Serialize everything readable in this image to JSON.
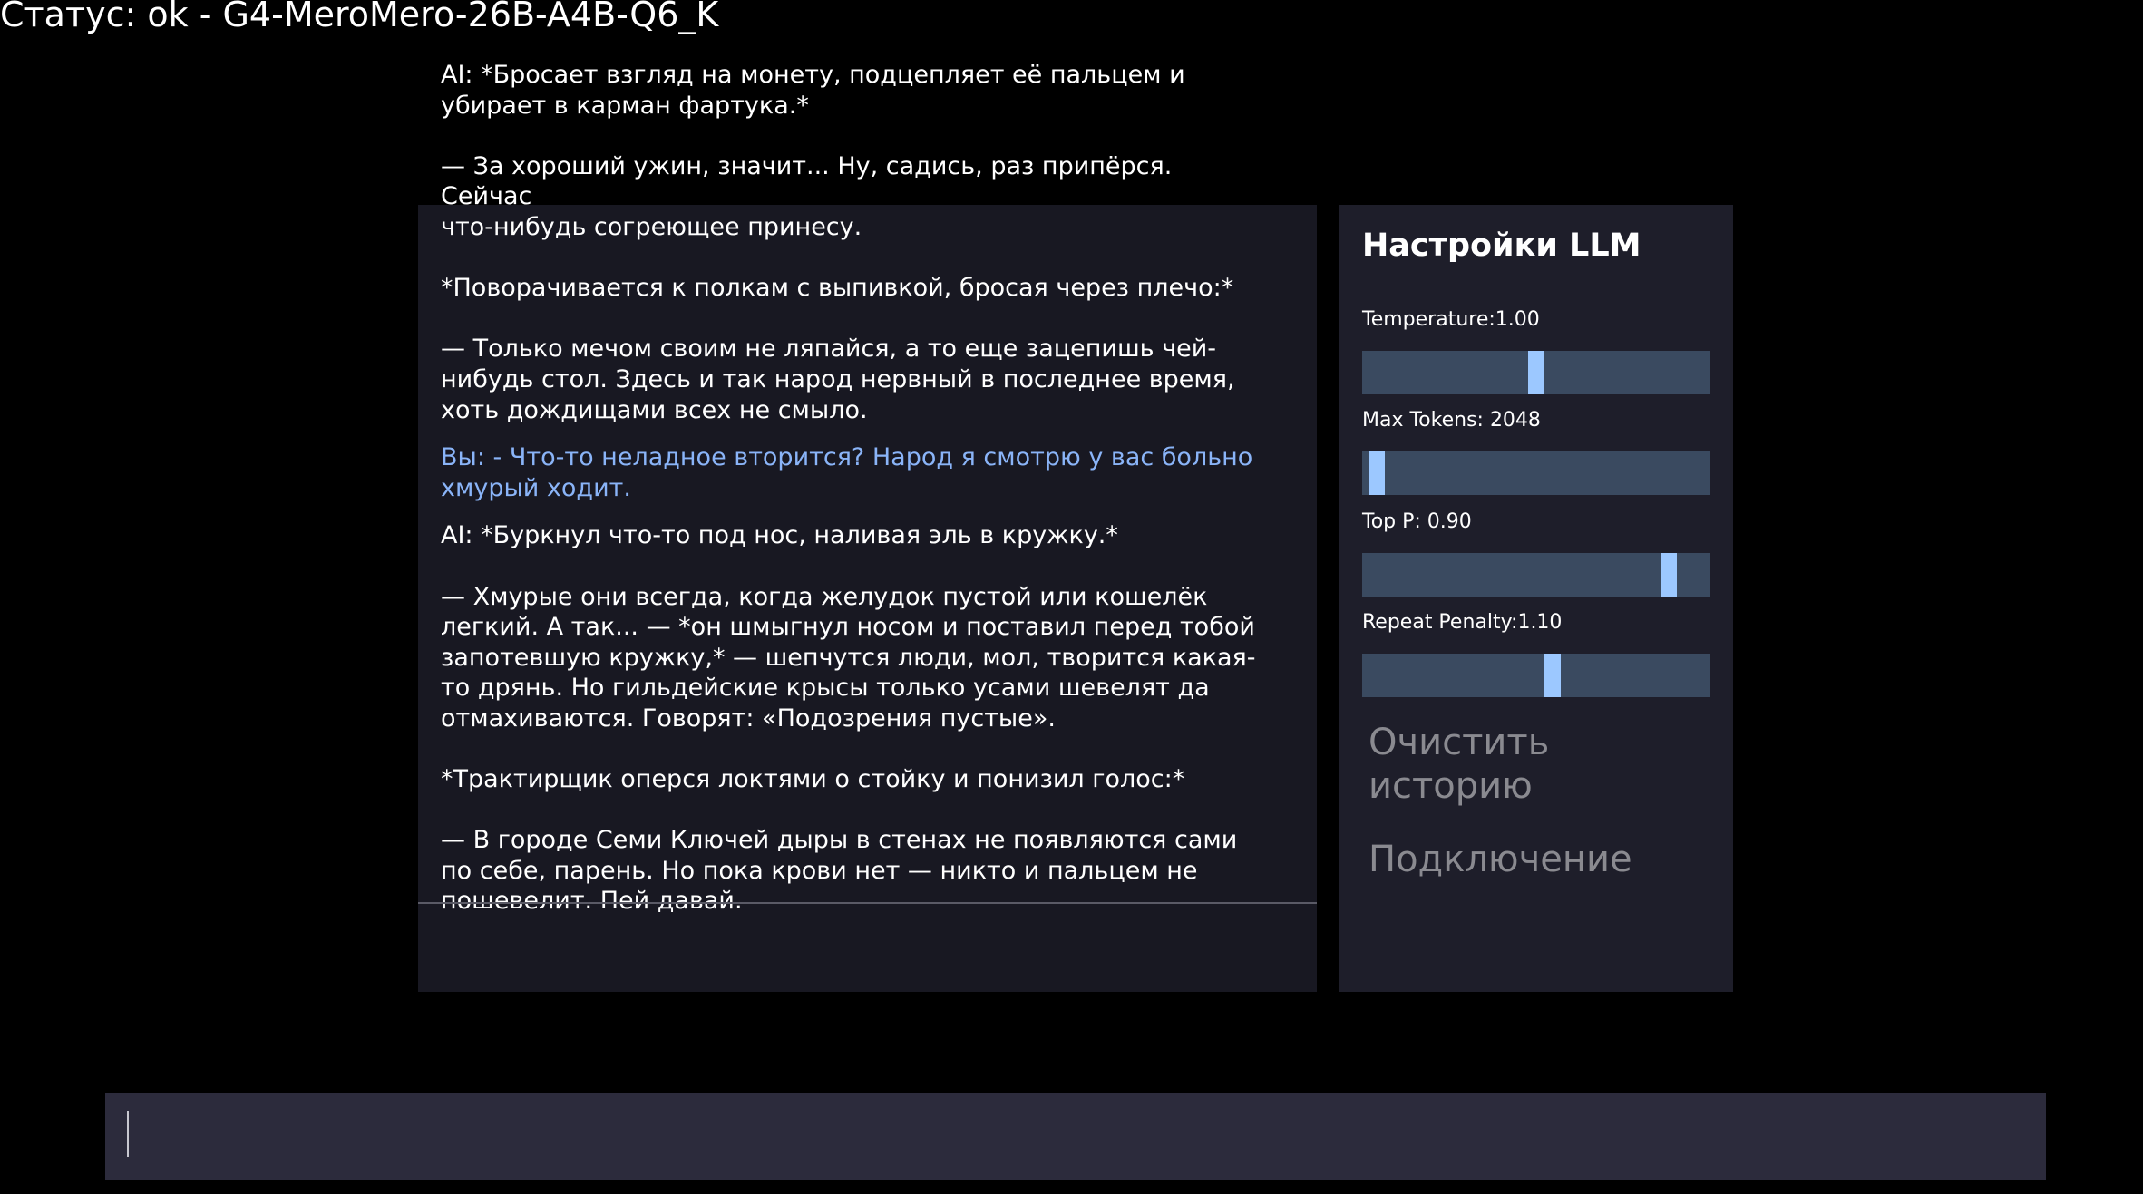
{
  "status": {
    "text": "Статус: ok - G4-MeroMero-26B-A4B-Q6_K"
  },
  "chat": {
    "messages": [
      {
        "role": "ai",
        "text": "AI: *Бросает взгляд на монету, подцепляет её пальцем и\nубирает в карман фартука.*\n\n— За хороший ужин, значит... Ну, садись, раз припёрся. Сейчас\nчто-нибудь согреющее принесу.\n\n*Поворачивается к полкам с выпивкой, бросая через плечо:*\n\n— Только мечом своим не ляпайся, а то еще зацепишь чей-\nнибудь стол. Здесь и так народ нервный в последнее время,\nхоть дождищами всех не смыло."
      },
      {
        "role": "user",
        "text": "Вы: - Что-то неладное вторится? Народ я смотрю у вас больно\nхмурый ходит."
      },
      {
        "role": "ai",
        "text": "AI: *Буркнул что-то под нос, наливая эль в кружку.*\n\n— Хмурые они всегда, когда желудок пустой или кошелёк\nлегкий. А так... — *он шмыгнул носом и поставил перед тобой\nзапотевшую кружку,* — шепчутся люди, мол, творится какая-\nто дрянь. Но гильдейские крысы только усами шевелят да\nотмахиваются. Говорят: «Подозрения пустые».\n\n*Трактирщик оперся локтями о стойку и понизил голос:*\n\n— В городе Семи Ключей дыры в стенах не появляются сами\nпо себе, парень. Но пока крови нет — никто и пальцем не\nпошевелит. Пей давай."
      }
    ]
  },
  "settings": {
    "title": "Настройки LLM",
    "sliders": [
      {
        "label": "Temperature:1.00",
        "level": 0.5
      },
      {
        "label": "Max Tokens: 2048",
        "level": 0.02
      },
      {
        "label": "Top P: 0.90",
        "level": 0.9
      },
      {
        "label": "Repeat Penalty:1.10",
        "level": 0.55
      }
    ],
    "clear_history_label": "Очистить\nисторию",
    "connection_label": "Подключение"
  },
  "input": {
    "value": "",
    "placeholder": ""
  },
  "colors": {
    "background": "#000000",
    "chat_panel": "#181822",
    "settings_panel": "#1e1e2a",
    "user_text": "#8ab4f8",
    "slider_track": "#3a4a60",
    "slider_thumb": "#9cc8ff",
    "input_bar": "#2c2b3c"
  }
}
